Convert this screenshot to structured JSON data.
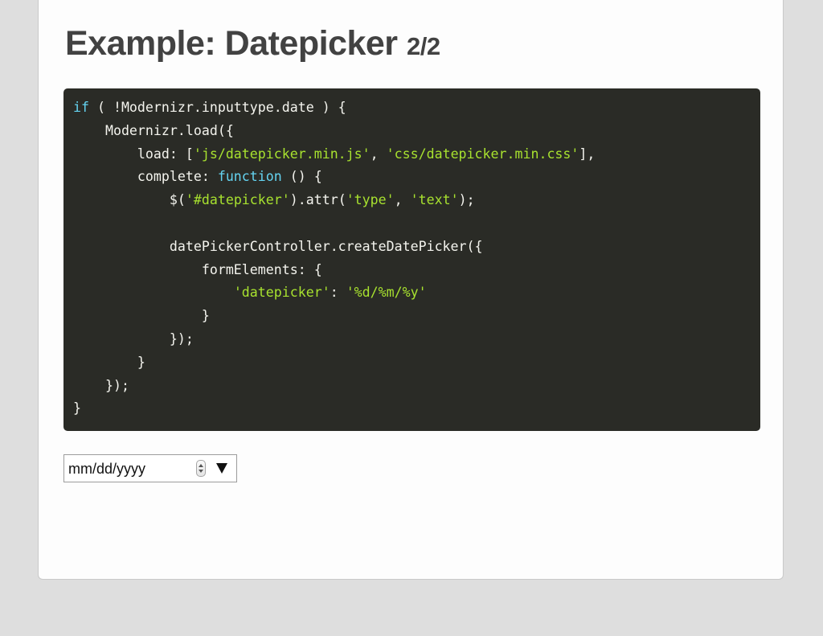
{
  "slide": {
    "title": "Example: Datepicker",
    "page_indicator": "2/2"
  },
  "code": {
    "language": "javascript",
    "colors": {
      "background": "#2a2b26",
      "text": "#f4f4ee",
      "keyword": "#64d3f0",
      "string": "#a8e22f"
    },
    "lines": [
      [
        {
          "t": "if",
          "c": "kw"
        },
        {
          "t": " ( !Modernizr.inputtype.date ) {"
        }
      ],
      [
        {
          "t": "    Modernizr.load({"
        }
      ],
      [
        {
          "t": "        load: ["
        },
        {
          "t": "'js/datepicker.min.js'",
          "c": "str"
        },
        {
          "t": ", "
        },
        {
          "t": "'css/datepicker.min.css'",
          "c": "str"
        },
        {
          "t": "],"
        }
      ],
      [
        {
          "t": "        complete: "
        },
        {
          "t": "function",
          "c": "kw"
        },
        {
          "t": " () {"
        }
      ],
      [
        {
          "t": "            $("
        },
        {
          "t": "'#datepicker'",
          "c": "str"
        },
        {
          "t": ").attr("
        },
        {
          "t": "'type'",
          "c": "str"
        },
        {
          "t": ", "
        },
        {
          "t": "'text'",
          "c": "str"
        },
        {
          "t": ");"
        }
      ],
      [],
      [
        {
          "t": "            datePickerController.createDatePicker({"
        }
      ],
      [
        {
          "t": "                formElements: {"
        }
      ],
      [
        {
          "t": "                    "
        },
        {
          "t": "'datepicker'",
          "c": "str"
        },
        {
          "t": ": "
        },
        {
          "t": "'%d/%m/%y'",
          "c": "str"
        }
      ],
      [
        {
          "t": "                }"
        }
      ],
      [
        {
          "t": "            });"
        }
      ],
      [
        {
          "t": "        }"
        }
      ],
      [
        {
          "t": "    });"
        }
      ],
      [
        {
          "t": "}"
        }
      ]
    ]
  },
  "date_input": {
    "value": "mm/dd/yyyy",
    "spinner_icon": "spinner-arrows-icon",
    "dropdown_icon": "dropdown-triangle-icon"
  }
}
